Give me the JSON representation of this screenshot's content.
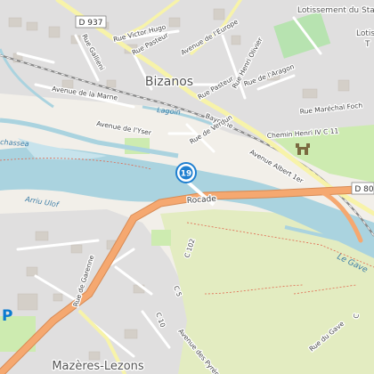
{
  "places": {
    "bizanos": "Bizanos",
    "mazeres": "Mazères-Lezons",
    "lotissement": "Lotissement du Stade",
    "lotis_top": "Lotis",
    "lotis_t": "T"
  },
  "roads": {
    "d937": "D 937",
    "victor_hugo": "Rue Victor Hugo",
    "europe": "Avenue de l'Europe",
    "gallieni": "Rue Gallieni",
    "pasteur": "Rue Pasteur",
    "henri_olivier": "Rue Henri Olivier",
    "aragon": "Rue de l'Aragon",
    "marne": "Avenue de la Marne",
    "pasteur2": "Rue Pasteur",
    "marechal_foch": "Rue Maréchal Foch",
    "bayonne": "Bayonne",
    "yser": "Avenue de l'Yser",
    "verdun": "Rue de Verdun",
    "henri_iv": "Chemin Henri IV C 11",
    "albert_1er": "Avenue Albert 1er",
    "d80": "D 80",
    "rocade": "Rocade",
    "garenne": "Rue de Garenne",
    "c102": "C 102",
    "c5": "C 5",
    "c10": "C 10",
    "pyrenees": "Avenue des Pyrénées",
    "rue_gave": "Rue du Gave",
    "c_left": "C"
  },
  "water": {
    "lagoin": "Lagoin",
    "gave": "Le Gave",
    "arriu": "Arriu Ulof",
    "chassea": "chassea"
  },
  "markers": {
    "poi_number": "19",
    "parking": "P"
  },
  "colors": {
    "land": "#f2efe9",
    "residential": "#e0dfdf",
    "water": "#aad3df",
    "green": "#cdebb0",
    "meadow": "#e3ecc1",
    "major_road": "#f5a870",
    "yellow_road": "#f7f3a9",
    "rail": "#8a8a8a",
    "poi_blue": "#1f7fd0"
  }
}
